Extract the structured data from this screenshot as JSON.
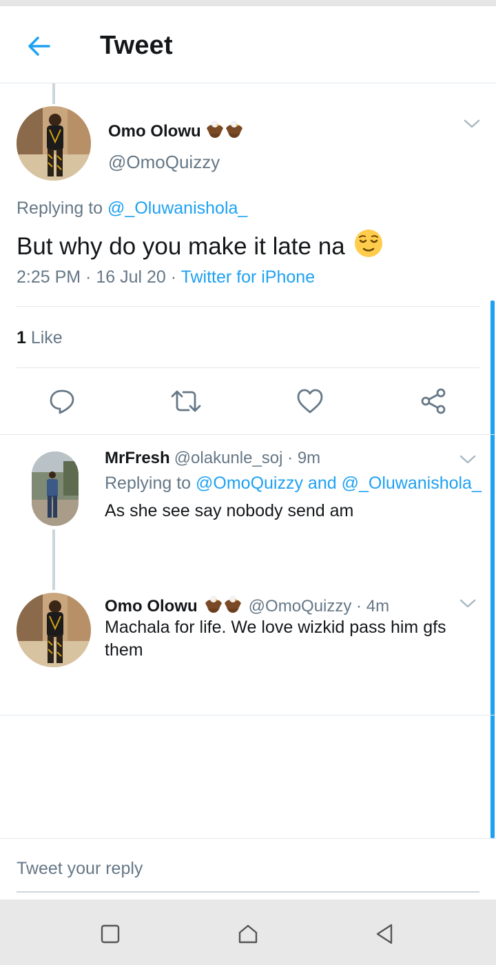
{
  "header": {
    "title": "Tweet",
    "back_icon": "arrow-left-icon"
  },
  "colors": {
    "accent": "#1da1f2",
    "muted": "#657786",
    "text": "#14171a",
    "divider": "#e1e8ed"
  },
  "main_tweet": {
    "name": "Omo Olowu",
    "name_emoji": "eagle-emoji",
    "handle": "@OmoQuizzy",
    "replying_prefix": "Replying to ",
    "replying_to": "@_Oluwanishola_",
    "text": "But why do you make it late na",
    "text_emoji": "relieved-face-emoji",
    "time": "2:25 PM",
    "sep1": " · ",
    "date": "16 Jul 20",
    "sep2": " · ",
    "source": "Twitter for iPhone",
    "like_count": "1",
    "like_label": " Like"
  },
  "actions": [
    "reply-icon",
    "retweet-icon",
    "like-icon",
    "share-icon"
  ],
  "replies": [
    {
      "name": "MrFresh",
      "handle": "@olakunle_soj",
      "age": " · 9m",
      "replying_prefix": "Replying to ",
      "replying_to": "@OmoQuizzy and @_Oluwanishola_",
      "text": "As she  see say nobody send am"
    },
    {
      "name": "Omo Olowu",
      "handle": "@OmoQuizzy",
      "age": " · 4m",
      "text": "Machala for life.  We love wizkid pass him gfs them"
    }
  ],
  "compose": {
    "placeholder": "Tweet your reply"
  },
  "navbar": [
    "recents-square-icon",
    "home-icon",
    "back-triangle-icon"
  ]
}
